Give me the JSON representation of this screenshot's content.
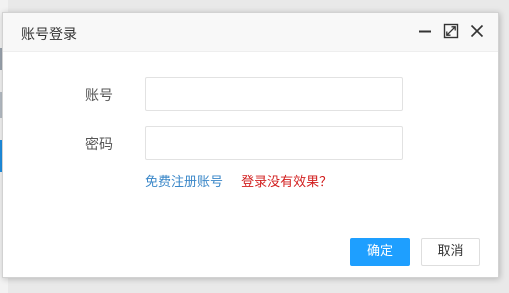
{
  "dialog": {
    "title": "账号登录",
    "controls": {
      "minimize_icon": "minimize-icon",
      "maximize_icon": "maximize-icon",
      "close_icon": "close-icon"
    }
  },
  "form": {
    "account": {
      "label": "账号",
      "value": "",
      "placeholder": ""
    },
    "password": {
      "label": "密码",
      "value": "",
      "placeholder": ""
    }
  },
  "links": {
    "register": "免费注册账号",
    "help": "登录没有效果？"
  },
  "buttons": {
    "ok": "确定",
    "cancel": "取消"
  },
  "colors": {
    "primary": "#1e9fff",
    "link": "#3a87c8",
    "warning_link": "#d21f1f"
  }
}
